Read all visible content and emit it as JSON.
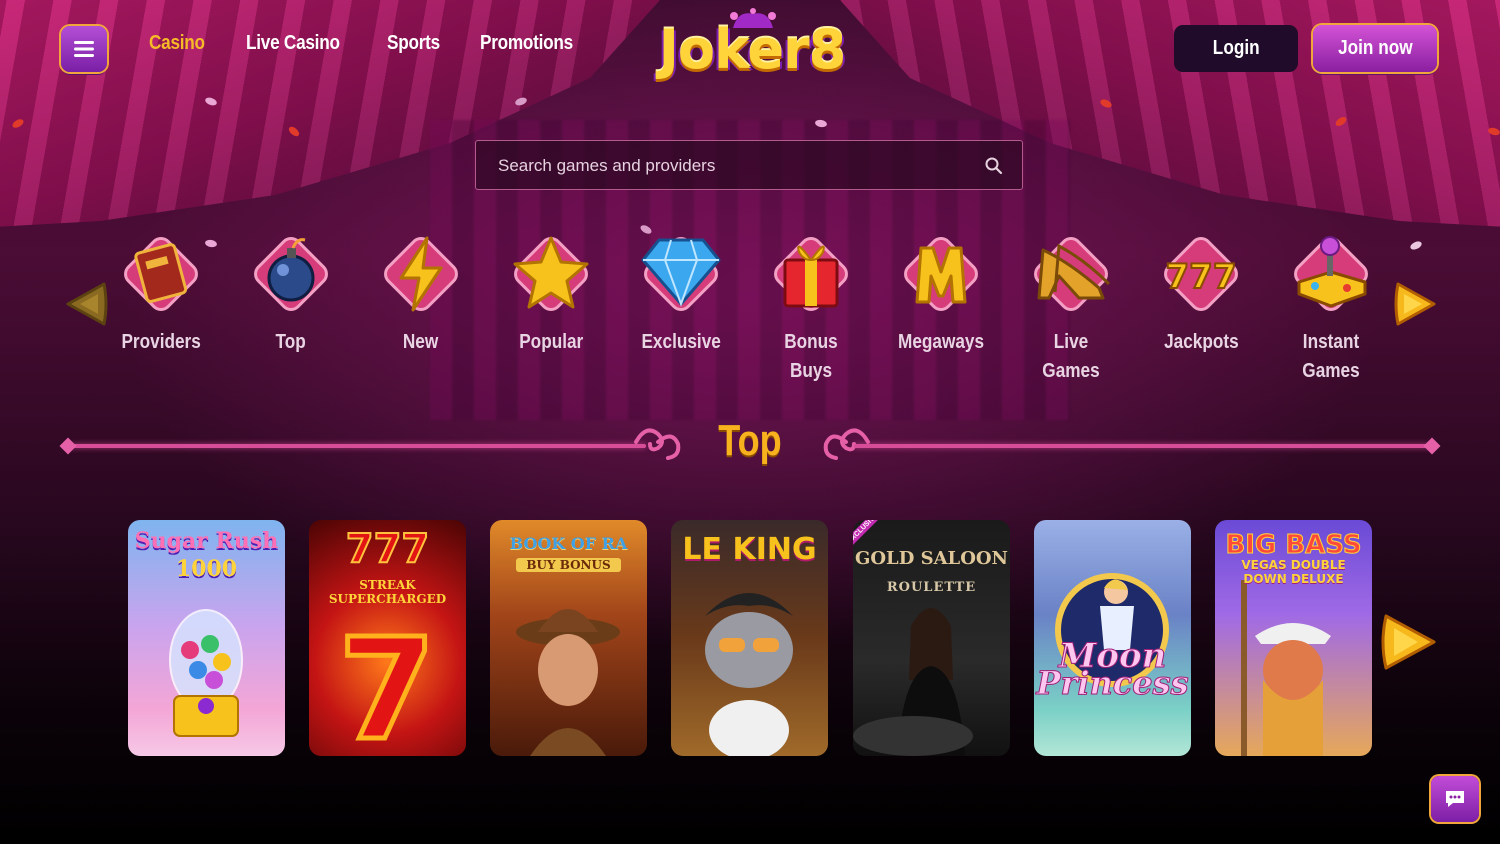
{
  "header": {
    "nav": [
      {
        "label": "Casino",
        "active": true
      },
      {
        "label": "Live Casino",
        "active": false
      },
      {
        "label": "Sports",
        "active": false
      },
      {
        "label": "Promotions",
        "active": false
      }
    ],
    "logo_text": "Joker8",
    "login_label": "Login",
    "join_label": "Join now"
  },
  "search": {
    "placeholder": "Search games and providers",
    "value": ""
  },
  "categories": [
    {
      "label": "Providers",
      "icon": "book-icon"
    },
    {
      "label": "Top",
      "icon": "bomb-icon"
    },
    {
      "label": "New",
      "icon": "lightning-icon"
    },
    {
      "label": "Popular",
      "icon": "star-icon"
    },
    {
      "label": "Exclusive",
      "icon": "diamond-icon"
    },
    {
      "label": "Bonus Buys",
      "icon": "gift-icon"
    },
    {
      "label": "Megaways",
      "icon": "megaways-m-icon"
    },
    {
      "label": "Live Games",
      "icon": "high-heels-icon"
    },
    {
      "label": "Jackpots",
      "icon": "777-icon"
    },
    {
      "label": "Instant Games",
      "icon": "joystick-icon"
    }
  ],
  "section": {
    "title": "Top"
  },
  "games": [
    {
      "title": "Sugar Rush",
      "subtitle": "1000"
    },
    {
      "title": "777",
      "subtitle": "STREAK SUPERCHARGED"
    },
    {
      "title": "BOOK OF RA",
      "subtitle": "BUY BONUS"
    },
    {
      "title": "LE KING",
      "subtitle": ""
    },
    {
      "title": "GOLD SALOON",
      "subtitle": "ROULETTE",
      "badge": "EXCLUSIVE"
    },
    {
      "title": "Moon",
      "subtitle": "Princess"
    },
    {
      "title": "BIG BASS",
      "subtitle": "VEGAS DOUBLE DOWN DELUXE"
    }
  ],
  "colors": {
    "accent_gold": "#f6b927",
    "accent_purple": "#b34fd6",
    "section_line": "#d84d98"
  }
}
